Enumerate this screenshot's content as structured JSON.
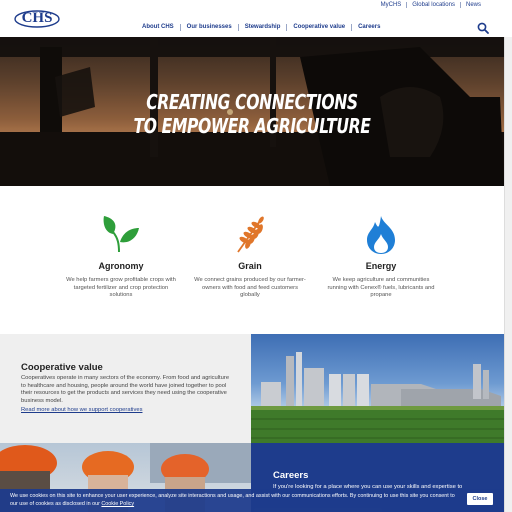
{
  "brand": {
    "logo_text": "CHS",
    "primary_color": "#1e3c8c"
  },
  "utility_nav": [
    "MyCHS",
    "Global locations",
    "News"
  ],
  "main_nav": [
    "About CHS",
    "Our businesses",
    "Stewardship",
    "Cooperative value",
    "Careers"
  ],
  "hero": {
    "line1": "CREATING CONNECTIONS",
    "line2": "TO EMPOWER AGRICULTURE"
  },
  "features": [
    {
      "title": "Agronomy",
      "text": "We help farmers grow profitable crops with targeted fertilizer and crop protection solutions",
      "icon": "leaf-icon",
      "color": "#2e9e3a"
    },
    {
      "title": "Grain",
      "text": "We connect grains produced by our farmer-owners with food and feed customers globally",
      "icon": "wheat-icon",
      "color": "#e0762a"
    },
    {
      "title": "Energy",
      "text": "We keep agriculture and communities running with Cenex® fuels, lubricants and propane",
      "icon": "flame-icon",
      "color": "#1f7fd6"
    }
  ],
  "cooperative": {
    "title": "Cooperative value",
    "text": "Cooperatives operate in many sectors of the economy. From food and agriculture to healthcare and housing, people around the world have joined together to pool their resources to get the products and services they need using the cooperative business model.",
    "link": "Read more about how we support cooperatives"
  },
  "careers": {
    "title": "Careers",
    "text": "If you're looking for a place where you can use your skills and expertise to"
  },
  "cookie": {
    "text": "We use cookies on this site to enhance your user experience, analyze site interactions and usage, and assist with our communications efforts. By continuing to use this site you consent to our use of cookies as disclosed in our",
    "link": "Cookie Policy",
    "close": "Close"
  }
}
